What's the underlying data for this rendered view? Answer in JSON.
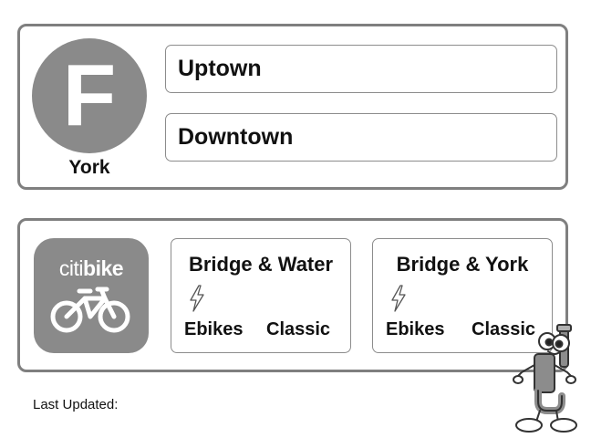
{
  "subway": {
    "route": "F",
    "station": "York",
    "directions": [
      "Uptown",
      "Downtown"
    ]
  },
  "citibike": {
    "logo": {
      "text_light": "citi",
      "text_bold": "bike"
    },
    "stations": [
      {
        "name": "Bridge & Water",
        "ebikes_label": "Ebikes",
        "classic_label": "Classic",
        "bolt_icon": "lightning-bolt-icon"
      },
      {
        "name": "Bridge & York",
        "ebikes_label": "Ebikes",
        "classic_label": "Classic",
        "bolt_icon": "lightning-bolt-icon"
      }
    ]
  },
  "footer": {
    "last_updated_label": "Last Updated:"
  },
  "colors": {
    "panel_border": "#7f7f7f",
    "badge_fill": "#8a8a8a",
    "text": "#111111"
  }
}
